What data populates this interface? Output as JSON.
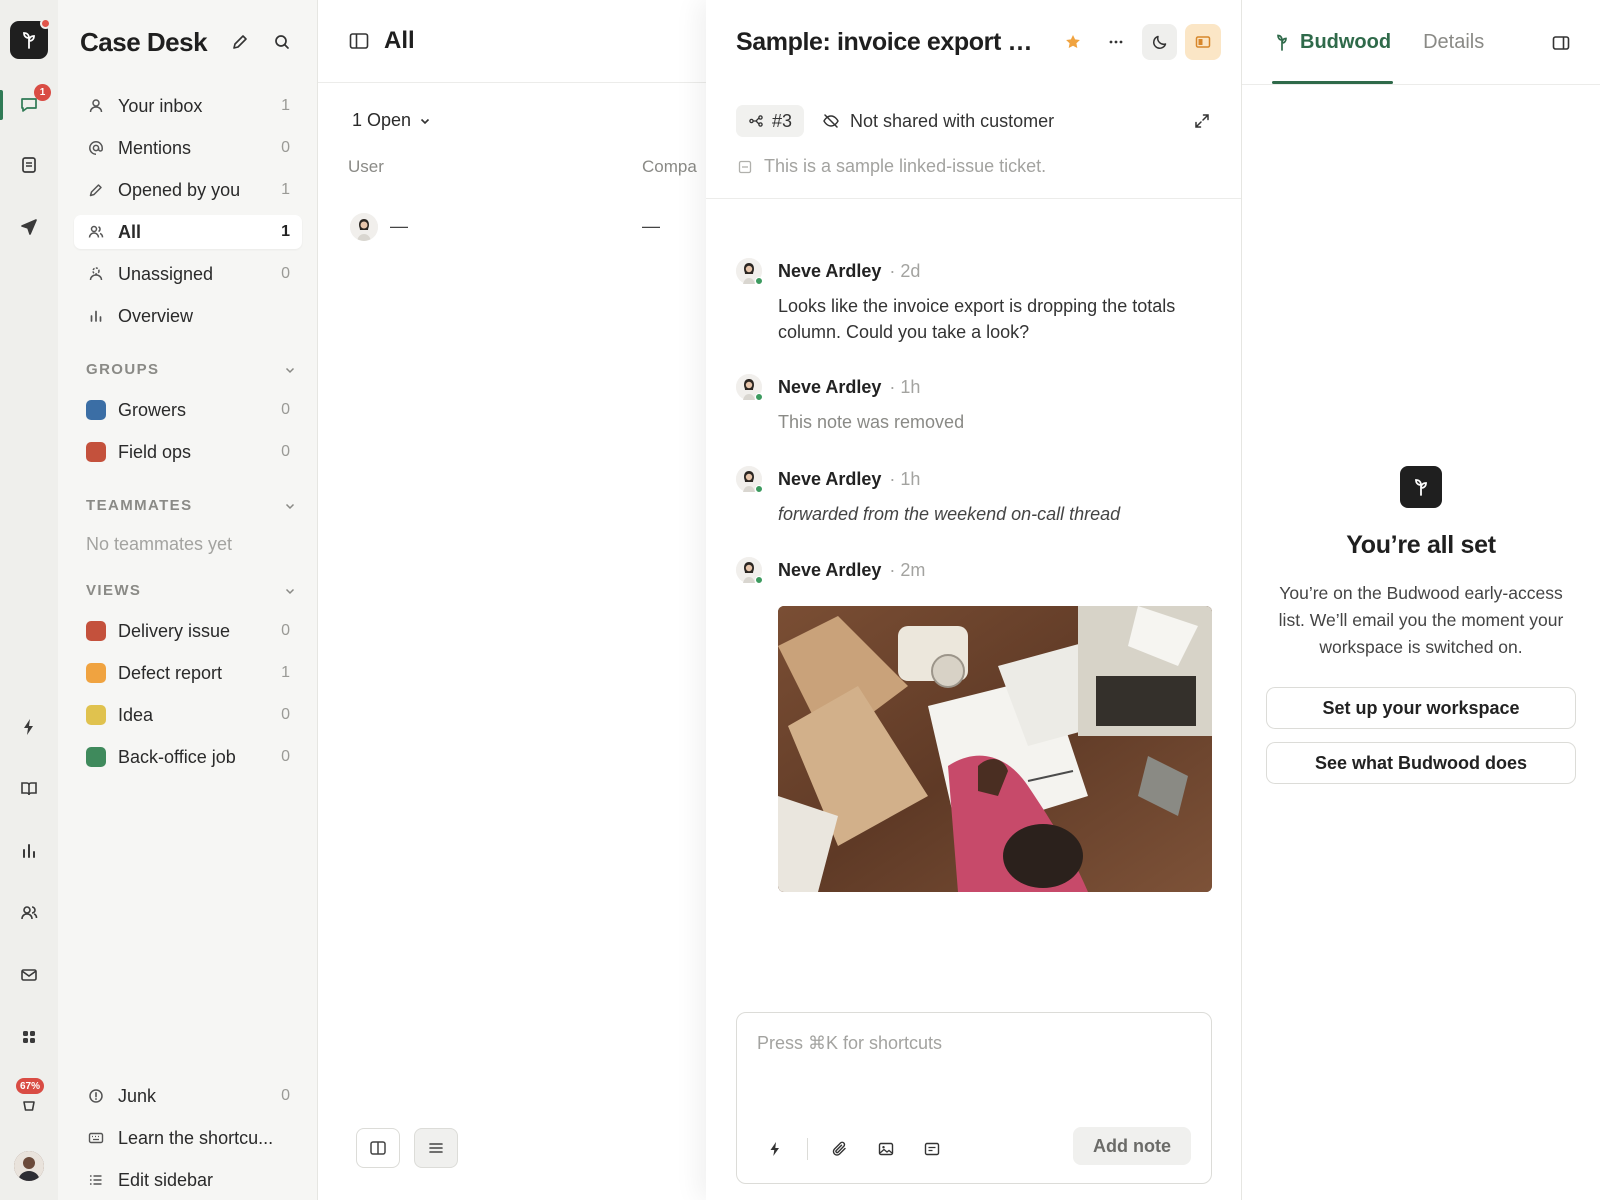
{
  "rail": {
    "inbox_badge": "1",
    "progress_badge": "67%"
  },
  "sidebar": {
    "title": "Case Desk",
    "items": [
      {
        "label": "Your inbox",
        "count": "1"
      },
      {
        "label": "Mentions",
        "count": "0"
      },
      {
        "label": "Opened by you",
        "count": "1"
      },
      {
        "label": "All",
        "count": "1"
      },
      {
        "label": "Unassigned",
        "count": "0"
      },
      {
        "label": "Overview",
        "count": ""
      }
    ],
    "groups_heading": "GROUPS",
    "groups": [
      {
        "label": "Growers",
        "count": "0",
        "color": "#3b6ea5"
      },
      {
        "label": "Field ops",
        "count": "0",
        "color": "#c4513c"
      }
    ],
    "teammates_heading": "TEAMMATES",
    "teammates_empty": "No teammates yet",
    "views_heading": "VIEWS",
    "views": [
      {
        "label": "Delivery issue",
        "count": "0",
        "color": "#c4513c"
      },
      {
        "label": "Defect report",
        "count": "1",
        "color": "#f0a340"
      },
      {
        "label": "Idea",
        "count": "0",
        "color": "#e0c24e"
      },
      {
        "label": "Back-office job",
        "count": "0",
        "color": "#3f8a5c"
      }
    ],
    "footer": [
      {
        "label": "Junk",
        "count": "0"
      },
      {
        "label": "Learn the shortcu...",
        "count": ""
      },
      {
        "label": "Edit sidebar",
        "count": ""
      }
    ]
  },
  "list": {
    "title": "All",
    "filter_label": "1 Open",
    "columns": [
      "User",
      "Compa"
    ],
    "rows": [
      {
        "user": "—",
        "company": "—"
      }
    ]
  },
  "conversation": {
    "title": "Sample: invoice export dr...",
    "ticket_id": "#3",
    "share_status": "Not shared with customer",
    "description": "This is a sample linked-issue ticket.",
    "messages": [
      {
        "author": "Neve Ardley",
        "time": "· 2d",
        "body": "Looks like the invoice export is dropping the totals column. Could you take a look?"
      },
      {
        "author": "Neve Ardley",
        "time": "· 1h",
        "body": "This note was removed"
      },
      {
        "author": "Neve Ardley",
        "time": "· 1h",
        "body": "forwarded from the weekend on-call thread"
      },
      {
        "author": "Neve Ardley",
        "time": "· 2m",
        "body": ""
      }
    ],
    "composer_placeholder": "Press ⌘K for shortcuts",
    "add_note_label": "Add note"
  },
  "panel": {
    "tabs": [
      "Budwood",
      "Details"
    ],
    "empty_title": "You’re all set",
    "empty_text": "You’re on the Budwood early-access list. We’ll email you the moment your workspace is switched on.",
    "cta_primary": "Set up your workspace",
    "cta_secondary": "See what Budwood does"
  },
  "colors": {
    "accent": "#2f6a4a",
    "badge": "#d94c44",
    "star": "#f0a340"
  }
}
